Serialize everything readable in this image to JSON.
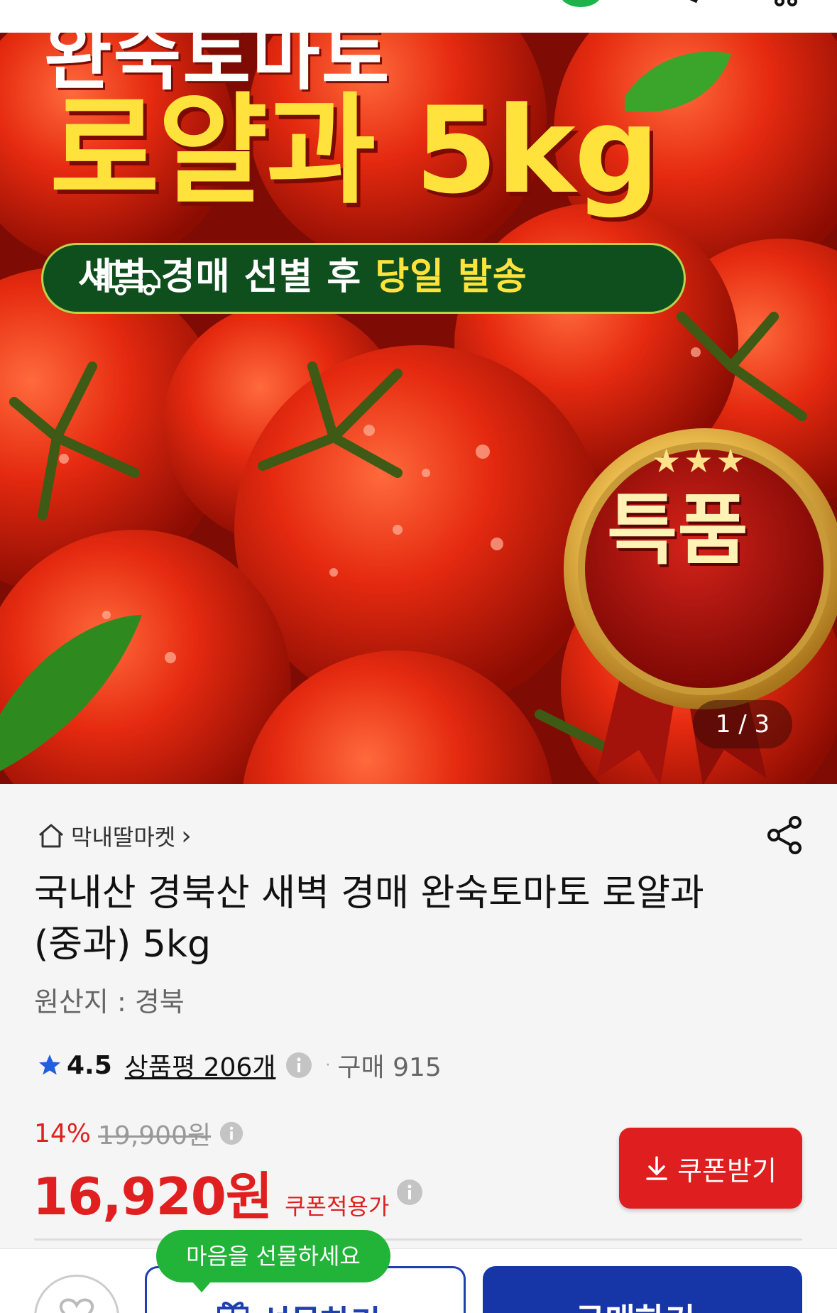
{
  "hero": {
    "line1": "완숙토마토",
    "line2": "로얄과 5kg",
    "pill_white1": "새벽 경매 선별 후",
    "pill_yellow": "당일 발송",
    "badge_stars": "★★★",
    "badge": "특품",
    "counter": "1 / 3"
  },
  "store": {
    "name": "막내딸마켓",
    "chevron": "›"
  },
  "product": {
    "title": "국내산 경북산 새벽 경매 완숙토마토 로얄과(중과) 5kg",
    "origin": "원산지 : 경북"
  },
  "rating": {
    "score": "4.5",
    "reviews": "상품평 206개",
    "purchase": "구매 915"
  },
  "price": {
    "discount_pct": "14%",
    "original": "19,900원",
    "sale": "16,920원",
    "coupon_label": "쿠폰적용가"
  },
  "coupon_button": {
    "label": "쿠폰받기"
  },
  "actionbar": {
    "tooltip": "마음을 선물하세요",
    "gift_label": "선물하기",
    "buy_label": "구매하기"
  },
  "colors": {
    "accent_red": "#df1f1f",
    "primary_blue": "#1635a7",
    "tooltip_green": "#22b339"
  },
  "icons": [
    "search-icon",
    "cart-icon",
    "home-icon",
    "share-icon",
    "star-icon",
    "info-icon",
    "download-icon",
    "heart-icon",
    "gift-icon"
  ]
}
